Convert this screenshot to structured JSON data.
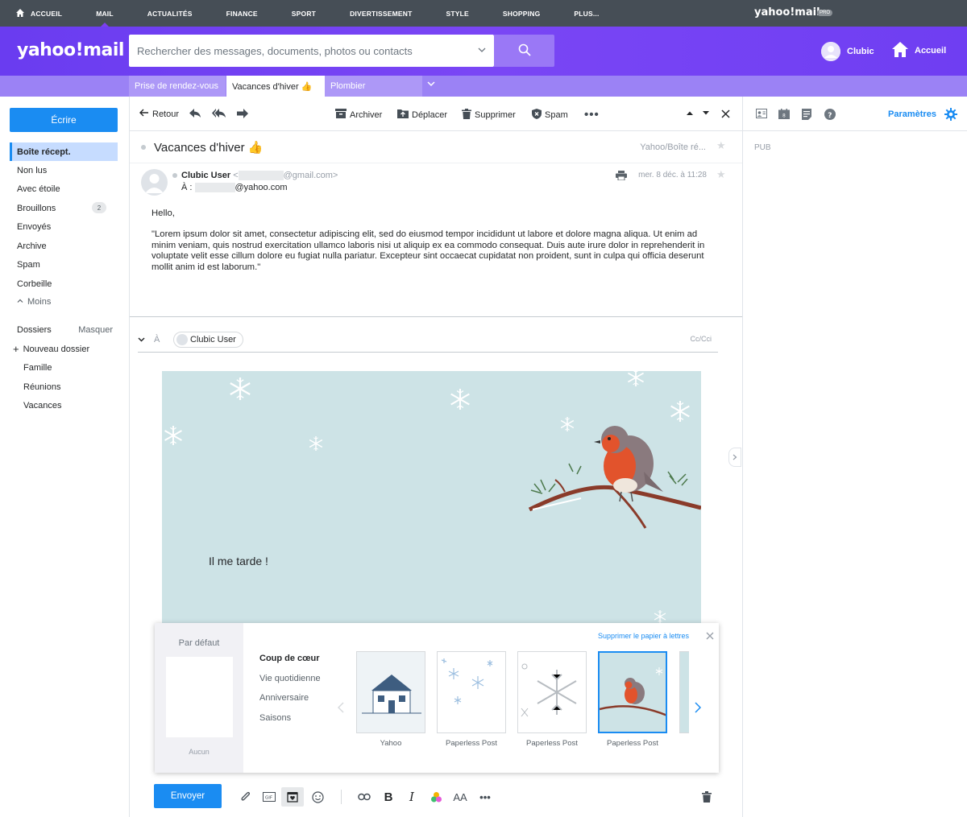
{
  "topnav": {
    "items": [
      "ACCUEIL",
      "MAIL",
      "ACTUALITÉS",
      "FINANCE",
      "SPORT",
      "DIVERTISSEMENT",
      "STYLE",
      "SHOPPING",
      "PLUS..."
    ],
    "brand": "yahoo!mail",
    "pro_badge": "PRO"
  },
  "header": {
    "logo": "yahoo!mail",
    "search_placeholder": "Rechercher des messages, documents, photos ou contacts",
    "user_name": "Clubic",
    "home_label": "Accueil"
  },
  "tabs": [
    "Prise de rendez-vous",
    "Vacances d'hiver 👍",
    "Plombier"
  ],
  "sidebar": {
    "compose_label": "Écrire",
    "folders": [
      {
        "label": "Boîte récept.",
        "count": ""
      },
      {
        "label": "Non lus",
        "count": ""
      },
      {
        "label": "Avec étoile",
        "count": ""
      },
      {
        "label": "Brouillons",
        "count": "2"
      },
      {
        "label": "Envoyés",
        "count": ""
      },
      {
        "label": "Archive",
        "count": ""
      },
      {
        "label": "Spam",
        "count": ""
      },
      {
        "label": "Corbeille",
        "count": ""
      },
      {
        "label": "Moins",
        "count": ""
      }
    ],
    "dossiers_label": "Dossiers",
    "masquer_label": "Masquer",
    "new_folder_label": "Nouveau dossier",
    "custom_folders": [
      "Famille",
      "Réunions",
      "Vacances"
    ]
  },
  "toolbar": {
    "back": "Retour",
    "archive": "Archiver",
    "move": "Déplacer",
    "delete": "Supprimer",
    "spam": "Spam"
  },
  "message": {
    "subject": "Vacances d'hiver 👍",
    "folder_path": "Yahoo/Boîte ré...",
    "sender_name": "Clubic User",
    "sender_email_suffix": "@gmail.com>",
    "to_label": "À :",
    "recipient_suffix": "@yahoo.com",
    "date": "mer. 8 déc. à 11:28",
    "greeting": "Hello,",
    "body": "\"Lorem ipsum dolor sit amet, consectetur adipiscing elit, sed do eiusmod tempor incididunt ut labore et dolore magna aliqua. Ut enim ad minim veniam, quis nostrud exercitation ullamco laboris nisi ut aliquip ex ea commodo consequat. Duis aute irure dolor in reprehenderit in voluptate velit esse cillum dolore eu fugiat nulla pariatur. Excepteur sint occaecat cupidatat non proident, sunt in culpa qui officia deserunt mollit anim id est laborum.\""
  },
  "reply": {
    "to_label": "À",
    "recipient_chip": "Clubic User",
    "cc_label": "Cc/Cci",
    "stationery_text": "Il me tarde !",
    "send_label": "Envoyer"
  },
  "picker": {
    "default_label": "Par défaut",
    "none_label": "Aucun",
    "categories": [
      "Coup de cœur",
      "Vie quotidienne",
      "Anniversaire",
      "Saisons"
    ],
    "remove_label": "Supprimer le papier à lettres",
    "thumbnails": [
      "Yahoo",
      "Paperless Post",
      "Paperless Post",
      "Paperless Post"
    ]
  },
  "right_panel": {
    "settings_label": "Paramètres",
    "ad_label": "PUB"
  },
  "colors": {
    "accent": "#1a8cf2",
    "header_purple": "#6f3ef2",
    "topnav": "#464e56"
  }
}
